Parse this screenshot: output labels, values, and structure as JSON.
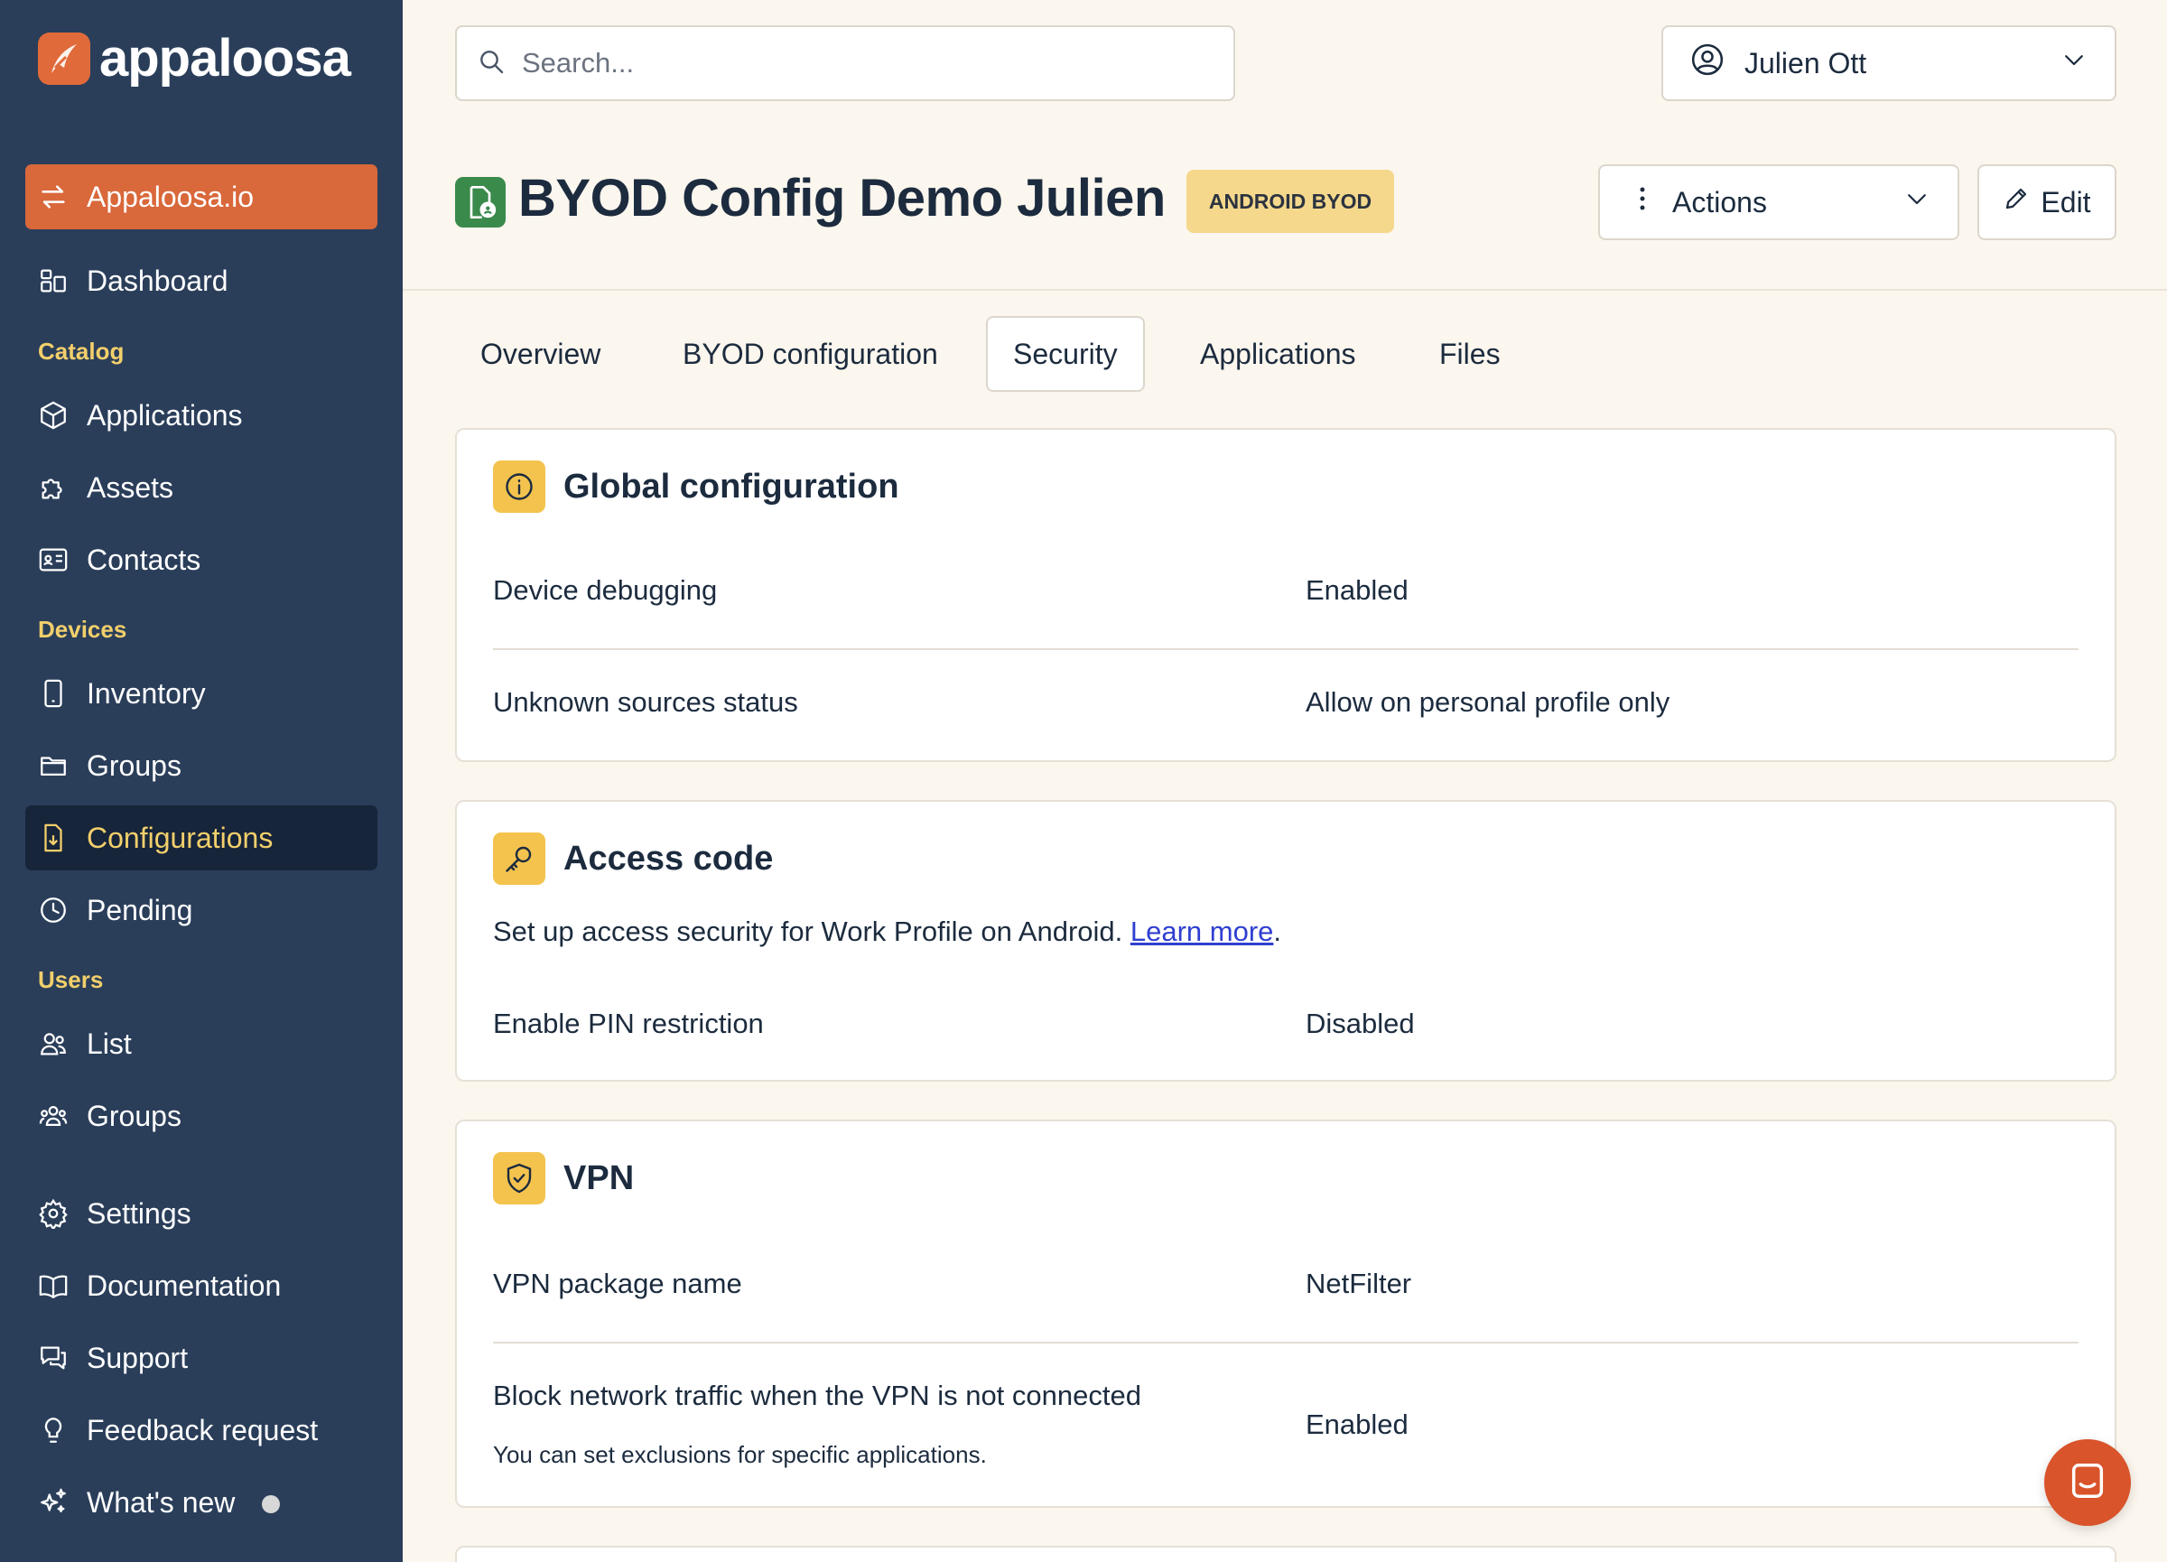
{
  "brand": {
    "name": "appaloosa"
  },
  "org_switcher": {
    "label": "Appaloosa.io"
  },
  "sidebar": {
    "dashboard": "Dashboard",
    "sections": {
      "catalog": "Catalog",
      "devices": "Devices",
      "users": "Users"
    },
    "catalog_items": [
      "Applications",
      "Assets",
      "Contacts"
    ],
    "device_items": [
      "Inventory",
      "Groups",
      "Configurations",
      "Pending"
    ],
    "user_items": [
      "List",
      "Groups"
    ],
    "bottom_items": [
      "Settings",
      "Documentation",
      "Support",
      "Feedback request",
      "What's new"
    ]
  },
  "search": {
    "placeholder": "Search..."
  },
  "user": {
    "name": "Julien Ott"
  },
  "header": {
    "title": "BYOD Config Demo Julien",
    "badge": "ANDROID BYOD",
    "actions_label": "Actions",
    "edit_label": "Edit"
  },
  "tabs": [
    "Overview",
    "BYOD configuration",
    "Security",
    "Applications",
    "Files"
  ],
  "active_tab": "Security",
  "global_config": {
    "title": "Global configuration",
    "rows": [
      {
        "label": "Device debugging",
        "value": "Enabled"
      },
      {
        "label": "Unknown sources status",
        "value": "Allow on personal profile only"
      }
    ]
  },
  "access_code": {
    "title": "Access code",
    "description": "Set up access security for Work Profile on Android.",
    "link": "Learn more",
    "rows": [
      {
        "label": "Enable PIN restriction",
        "value": "Disabled"
      }
    ]
  },
  "vpn": {
    "title": "VPN",
    "rows": [
      {
        "label": "VPN package name",
        "value": "NetFilter"
      },
      {
        "label": "Block network traffic when the VPN is not connected",
        "sub": "You can set exclusions for specific applications.",
        "value": "Enabled"
      }
    ]
  },
  "colors": {
    "sidebar": "#2a3e5a",
    "accent": "#d9683b",
    "highlight": "#f2cf6b",
    "icon_bg": "#f3c34e",
    "background": "#fbf6ee"
  }
}
